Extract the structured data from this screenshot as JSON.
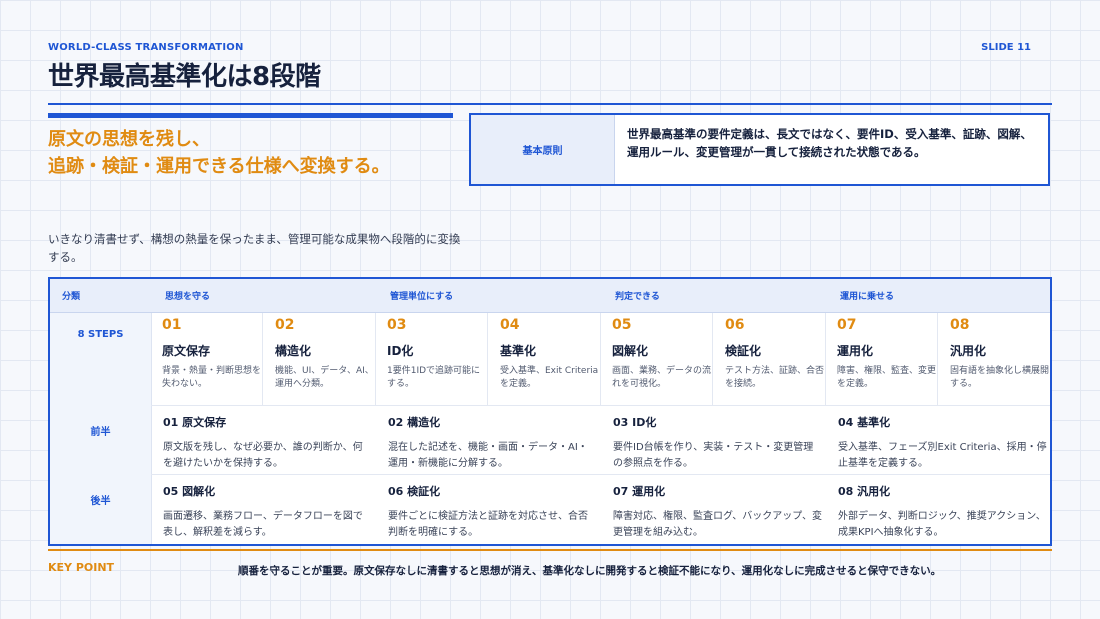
{
  "header": {
    "eyebrow": "WORLD-CLASS TRANSFORMATION",
    "slide_label": "SLIDE 11",
    "title": "世界最高基準化は8段階"
  },
  "lead": {
    "line1": "原文の思想を残し、",
    "line2": "追跡・検証・運用できる仕様へ変換する。"
  },
  "principle": {
    "label": "基本原則",
    "text": "世界最高基準の要件定義は、長文ではなく、要件ID、受入基準、証跡、図解、運用ルール、変更管理が一貫して接続された状態である。"
  },
  "description": "いきなり清書せず、構想の熱量を保ったまま、管理可能な成果物へ段階的に変換する。",
  "table": {
    "headers": [
      "分類",
      "思想を守る",
      "管理単位にする",
      "判定できる",
      "運用に乗せる"
    ],
    "steps_label": "8 STEPS",
    "steps": [
      {
        "num": "01",
        "title": "原文保存",
        "desc": "背景・熱量・判断思想を失わない。"
      },
      {
        "num": "02",
        "title": "構造化",
        "desc": "機能、UI、データ、AI、運用へ分類。"
      },
      {
        "num": "03",
        "title": "ID化",
        "desc": "1要件1IDで追跡可能にする。"
      },
      {
        "num": "04",
        "title": "基準化",
        "desc": "受入基準、Exit Criteriaを定義。"
      },
      {
        "num": "05",
        "title": "図解化",
        "desc": "画面、業務、データの流れを可視化。"
      },
      {
        "num": "06",
        "title": "検証化",
        "desc": "テスト方法、証跡、合否を接続。"
      },
      {
        "num": "07",
        "title": "運用化",
        "desc": "障害、権限、監査、変更を定義。"
      },
      {
        "num": "08",
        "title": "汎用化",
        "desc": "固有語を抽象化し横展開する。"
      }
    ],
    "first_half": {
      "label": "前半",
      "cells": [
        {
          "title": "01 原文保存",
          "desc": "原文版を残し、なぜ必要か、誰の判断か、何を避けたいかを保持する。"
        },
        {
          "title": "02 構造化",
          "desc": "混在した記述を、機能・画面・データ・AI・運用・新機能に分解する。"
        },
        {
          "title": "03 ID化",
          "desc": "要件ID台帳を作り、実装・テスト・変更管理の参照点を作る。"
        },
        {
          "title": "04 基準化",
          "desc": "受入基準、フェーズ別Exit Criteria、採用・停止基準を定義する。"
        }
      ]
    },
    "second_half": {
      "label": "後半",
      "cells": [
        {
          "title": "05 図解化",
          "desc": "画面遷移、業務フロー、データフローを図で表し、解釈差を減らす。"
        },
        {
          "title": "06 検証化",
          "desc": "要件ごとに検証方法と証跡を対応させ、合否判断を明確にする。"
        },
        {
          "title": "07 運用化",
          "desc": "障害対応、権限、監査ログ、バックアップ、変更管理を組み込む。"
        },
        {
          "title": "08 汎用化",
          "desc": "外部データ、判断ロジック、推奨アクション、成果KPIへ抽象化する。"
        }
      ]
    }
  },
  "key_point": {
    "label": "KEY POINT",
    "text": "順番を守ることが重要。原文保存なしに清書すると思想が消え、基準化なしに開発すると検証不能になり、運用化なしに完成させると保守できない。"
  },
  "colors": {
    "accent_blue": "#1f56d4",
    "accent_orange": "#e08b12"
  }
}
